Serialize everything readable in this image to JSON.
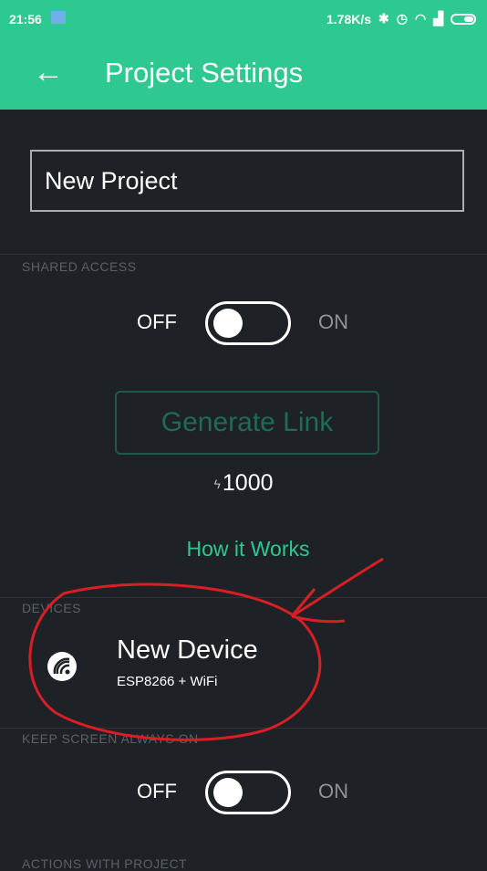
{
  "status_bar": {
    "time": "21:56",
    "network_speed": "1.78K/s"
  },
  "header": {
    "title": "Project Settings",
    "back_icon": "arrow-left-icon"
  },
  "project": {
    "name": "New Project"
  },
  "shared_access": {
    "section_label": "SHARED ACCESS",
    "toggle_off_label": "OFF",
    "toggle_on_label": "ON",
    "toggle_state": "off",
    "generate_link_label": "Generate Link",
    "energy_amount": "1000",
    "how_it_works_label": "How it Works"
  },
  "devices": {
    "section_label": "DEVICES",
    "items": [
      {
        "name": "New Device",
        "type": "ESP8266 + WiFi",
        "icon": "chip-icon"
      }
    ]
  },
  "keep_screen_on": {
    "section_label": "KEEP SCREEN ALWAYS ON",
    "toggle_off_label": "OFF",
    "toggle_on_label": "ON",
    "toggle_state": "off"
  },
  "actions": {
    "section_label": "ACTIONS WITH PROJECT"
  },
  "colors": {
    "accent": "#2ec891",
    "background": "#1e2125",
    "annotation": "#d81f26",
    "disabled_button": "#1d5b48"
  }
}
